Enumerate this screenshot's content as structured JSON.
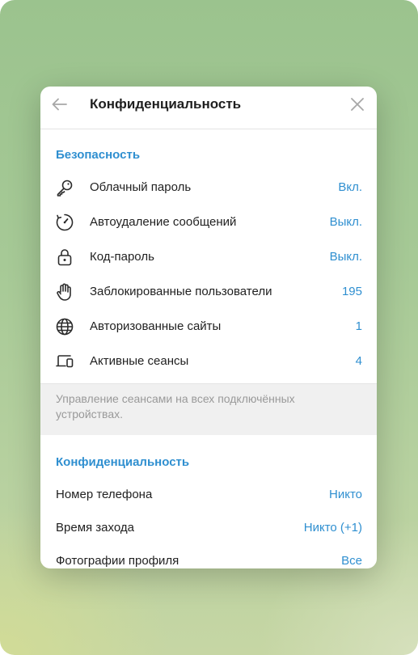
{
  "dialog": {
    "title": "Конфиденциальность",
    "back_icon": "arrow-left-icon",
    "close_icon": "close-icon"
  },
  "security": {
    "header": "Безопасность",
    "items": [
      {
        "icon": "key-icon",
        "label": "Облачный пароль",
        "value": "Вкл."
      },
      {
        "icon": "timer-icon",
        "label": "Автоудаление сообщений",
        "value": "Выкл."
      },
      {
        "icon": "lock-icon",
        "label": "Код-пароль",
        "value": "Выкл."
      },
      {
        "icon": "hand-icon",
        "label": "Заблокированные пользователи",
        "value": "195"
      },
      {
        "icon": "globe-icon",
        "label": "Авторизованные сайты",
        "value": "1"
      },
      {
        "icon": "devices-icon",
        "label": "Активные сеансы",
        "value": "4"
      }
    ],
    "note": "Управление сеансами на всех подключённых устройствах."
  },
  "privacy": {
    "header": "Конфиденциальность",
    "items": [
      {
        "label": "Номер телефона",
        "value": "Никто"
      },
      {
        "label": "Время захода",
        "value": "Никто (+1)"
      },
      {
        "label": "Фотографии профиля",
        "value": "Все"
      }
    ]
  },
  "colors": {
    "accent": "#2f8fd0",
    "text": "#1f1f1f",
    "muted": "#999999",
    "icon": "#2b2b2b"
  }
}
